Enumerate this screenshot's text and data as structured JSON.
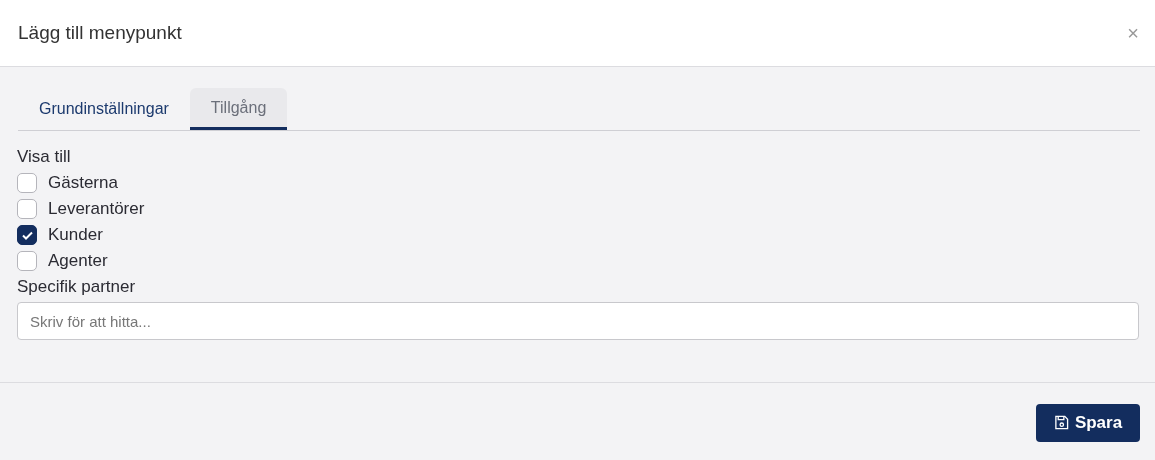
{
  "dialog": {
    "title": "Lägg till menypunkt",
    "close": "×"
  },
  "tabs": [
    {
      "label": "Grundinställningar",
      "selected": false
    },
    {
      "label": "Tillgång",
      "selected": true
    }
  ],
  "visibility": {
    "label": "Visa till",
    "options": [
      {
        "label": "Gästerna",
        "checked": false
      },
      {
        "label": "Leverantörer",
        "checked": false
      },
      {
        "label": "Kunder",
        "checked": true
      },
      {
        "label": "Agenter",
        "checked": false
      }
    ]
  },
  "partner": {
    "label": "Specifik partner",
    "placeholder": "Skriv för att hitta..."
  },
  "save_button": "Spara"
}
